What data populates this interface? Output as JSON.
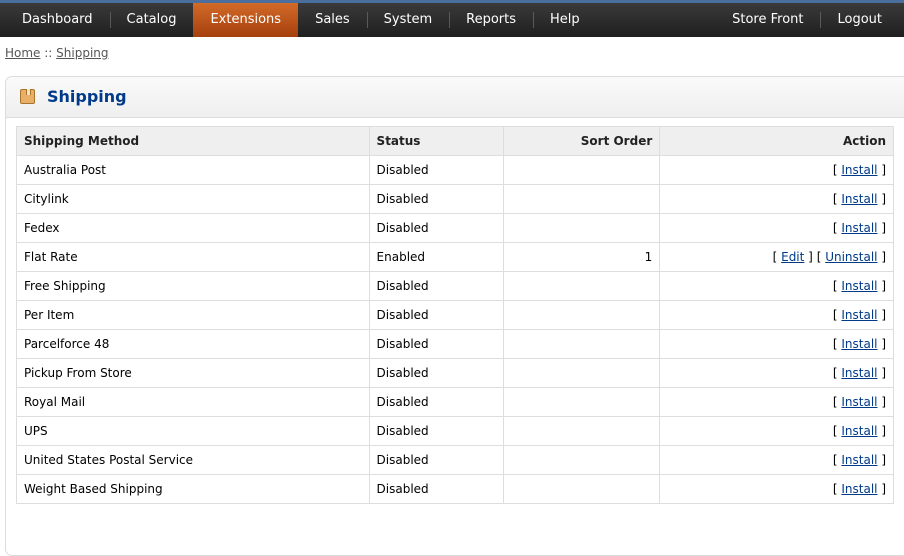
{
  "nav": {
    "left": [
      {
        "label": "Dashboard",
        "active": false
      },
      {
        "label": "Catalog",
        "active": false
      },
      {
        "label": "Extensions",
        "active": true
      },
      {
        "label": "Sales",
        "active": false
      },
      {
        "label": "System",
        "active": false
      },
      {
        "label": "Reports",
        "active": false
      },
      {
        "label": "Help",
        "active": false
      }
    ],
    "right": [
      {
        "label": "Store Front"
      },
      {
        "label": "Logout"
      }
    ]
  },
  "breadcrumb": {
    "home": "Home",
    "separator": " :: ",
    "current": "Shipping"
  },
  "box": {
    "icon": "box-icon",
    "title": "Shipping"
  },
  "table": {
    "headers": {
      "method": "Shipping Method",
      "status": "Status",
      "sort_order": "Sort Order",
      "action": "Action"
    },
    "rows": [
      {
        "method": "Australia Post",
        "status": "Disabled",
        "sort_order": "",
        "actions": [
          "Install"
        ]
      },
      {
        "method": "Citylink",
        "status": "Disabled",
        "sort_order": "",
        "actions": [
          "Install"
        ]
      },
      {
        "method": "Fedex",
        "status": "Disabled",
        "sort_order": "",
        "actions": [
          "Install"
        ]
      },
      {
        "method": "Flat Rate",
        "status": "Enabled",
        "sort_order": "1",
        "actions": [
          "Edit",
          "Uninstall"
        ]
      },
      {
        "method": "Free Shipping",
        "status": "Disabled",
        "sort_order": "",
        "actions": [
          "Install"
        ]
      },
      {
        "method": "Per Item",
        "status": "Disabled",
        "sort_order": "",
        "actions": [
          "Install"
        ]
      },
      {
        "method": "Parcelforce 48",
        "status": "Disabled",
        "sort_order": "",
        "actions": [
          "Install"
        ]
      },
      {
        "method": "Pickup From Store",
        "status": "Disabled",
        "sort_order": "",
        "actions": [
          "Install"
        ]
      },
      {
        "method": "Royal Mail",
        "status": "Disabled",
        "sort_order": "",
        "actions": [
          "Install"
        ]
      },
      {
        "method": "UPS",
        "status": "Disabled",
        "sort_order": "",
        "actions": [
          "Install"
        ]
      },
      {
        "method": "United States Postal Service",
        "status": "Disabled",
        "sort_order": "",
        "actions": [
          "Install"
        ]
      },
      {
        "method": "Weight Based Shipping",
        "status": "Disabled",
        "sort_order": "",
        "actions": [
          "Install"
        ]
      }
    ]
  },
  "colors": {
    "nav_bg": "#2a2a2a",
    "nav_active": "#c25a1e",
    "title": "#003a88",
    "link": "#003a88"
  }
}
